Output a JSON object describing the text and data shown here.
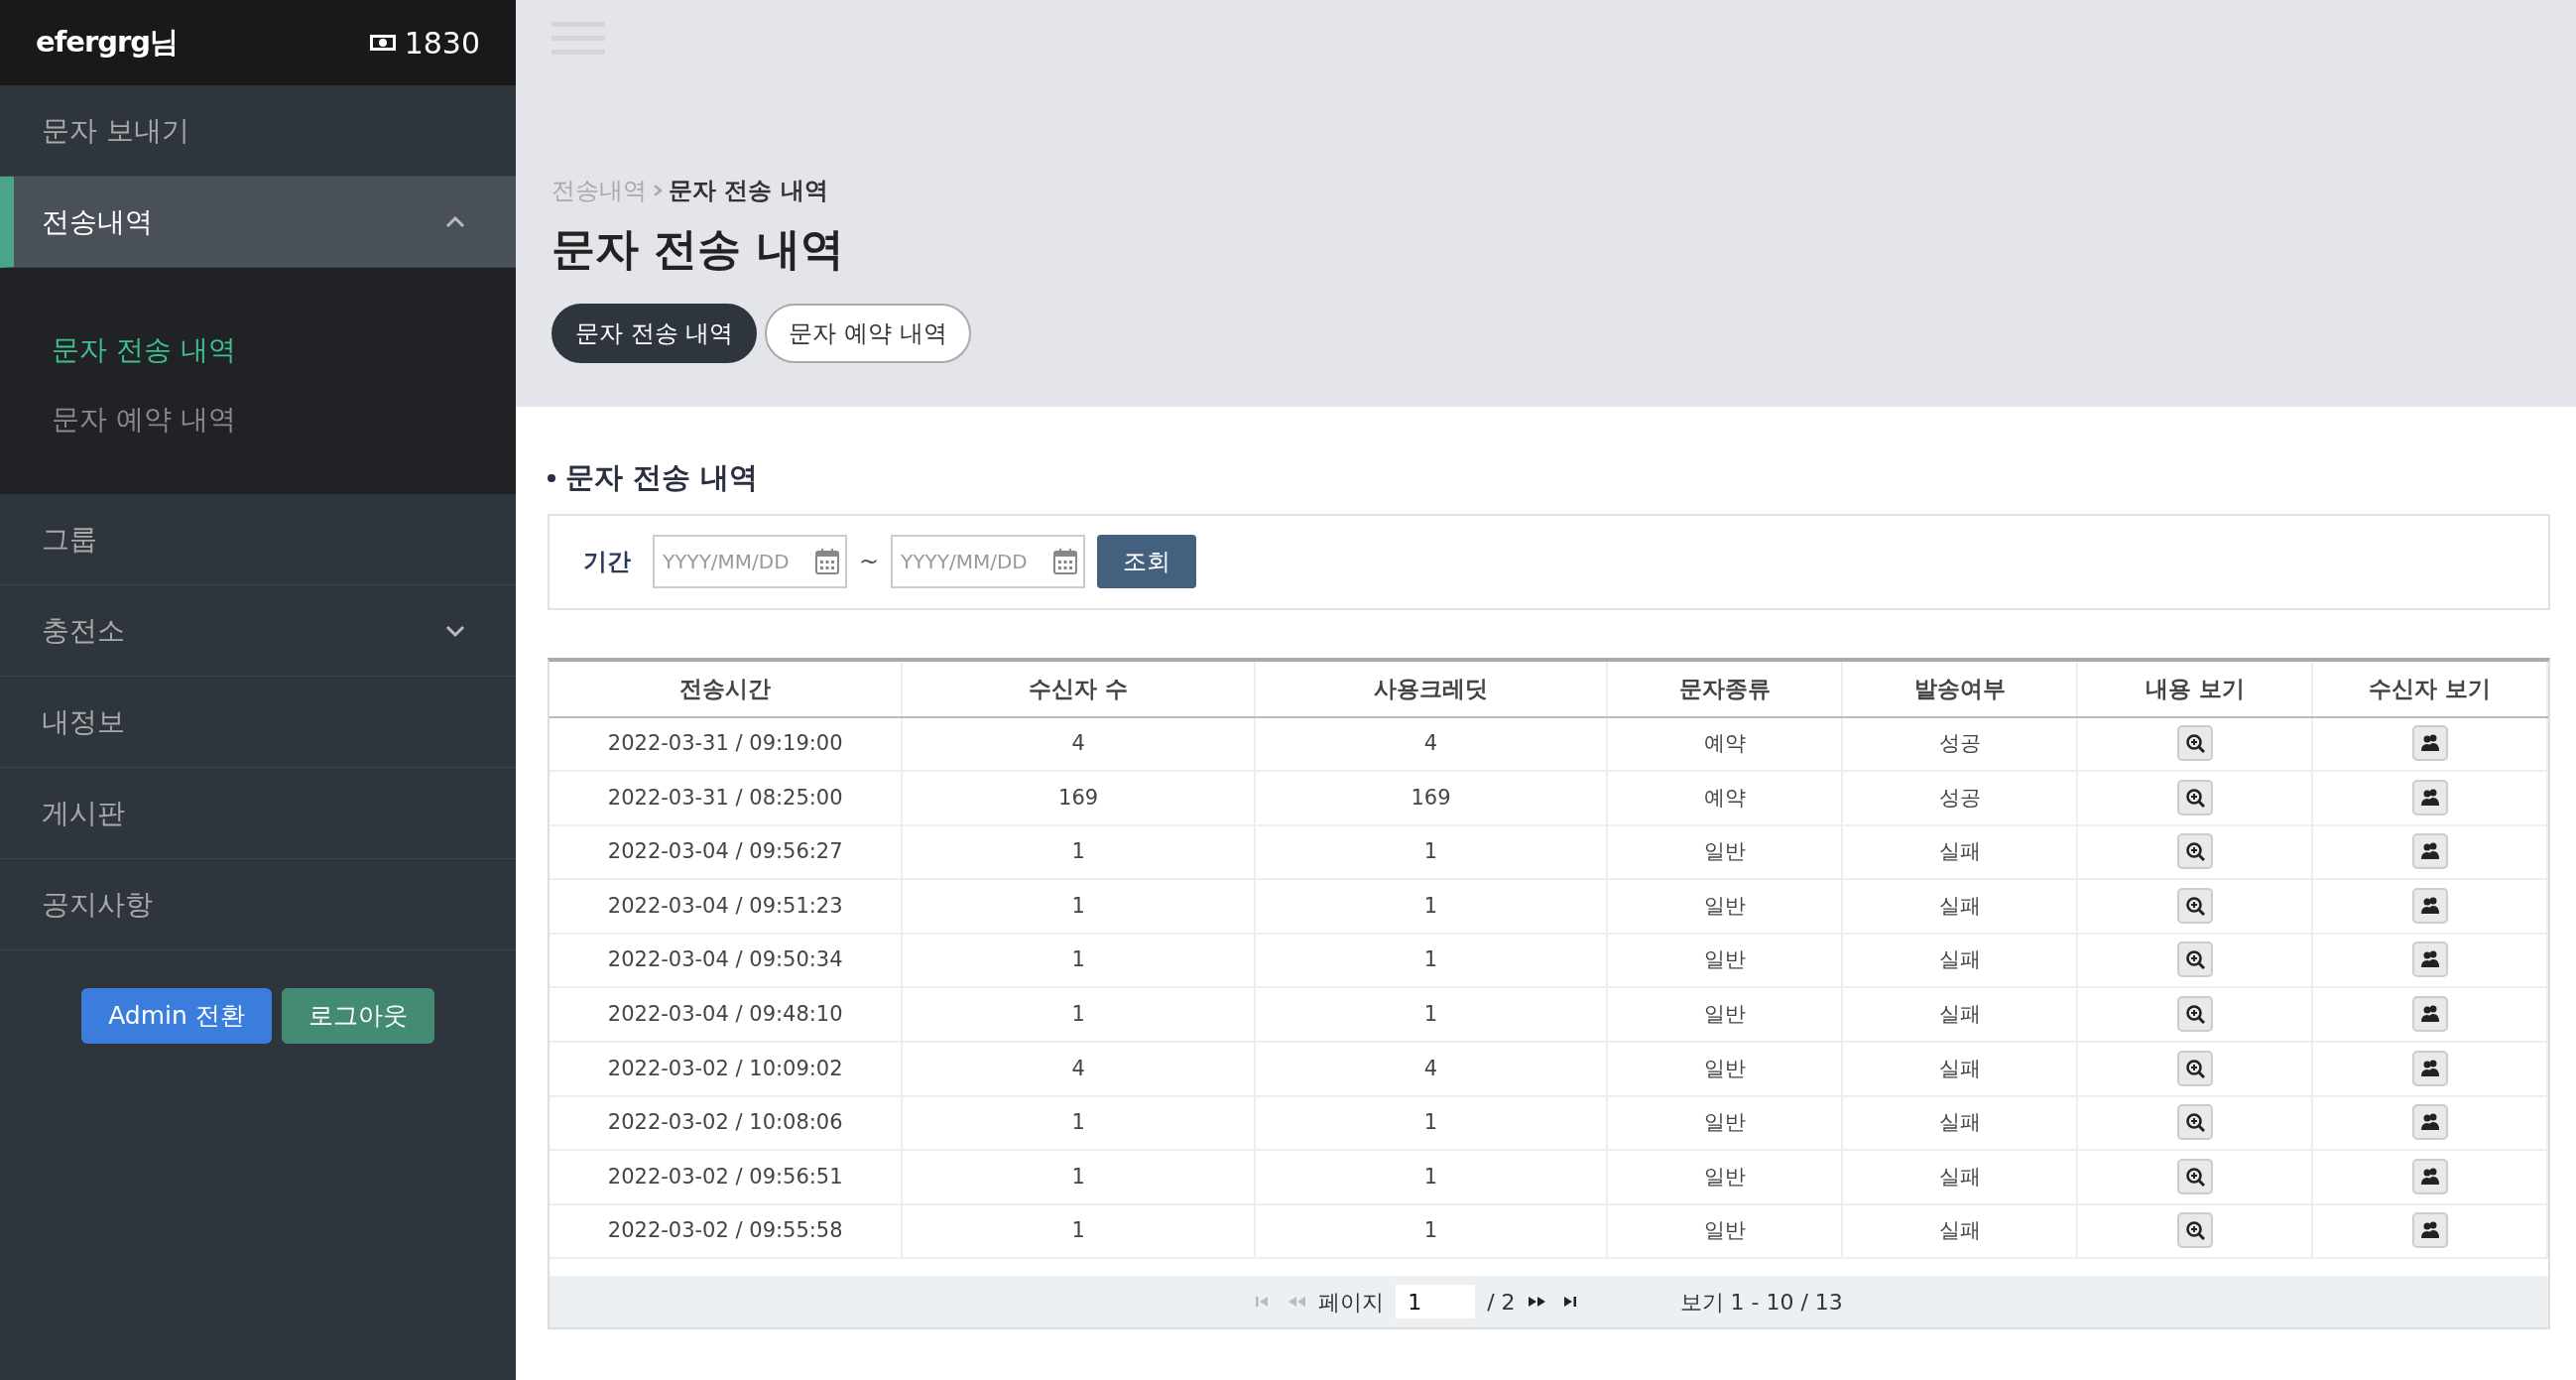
{
  "sidebar": {
    "user": "efergrg님",
    "credit": "1830",
    "menu": [
      {
        "label": "문자 보내기",
        "kind": "link",
        "selected": false
      },
      {
        "label": "전송내역",
        "kind": "group",
        "selected": true,
        "expanded": true,
        "children": [
          {
            "label": "문자 전송 내역",
            "selected": true
          },
          {
            "label": "문자 예약 내역",
            "selected": false
          }
        ]
      },
      {
        "label": "그룹",
        "kind": "link",
        "selected": false
      },
      {
        "label": "충전소",
        "kind": "group",
        "selected": false,
        "expanded": false
      },
      {
        "label": "내정보",
        "kind": "link",
        "selected": false
      },
      {
        "label": "게시판",
        "kind": "link",
        "selected": false
      },
      {
        "label": "공지사항",
        "kind": "link",
        "selected": false
      }
    ],
    "buttons": [
      {
        "label": "Admin 전환",
        "kind": "primary"
      },
      {
        "label": "로그아웃",
        "kind": "success"
      }
    ]
  },
  "breadcrumb": {
    "parent": "전송내역",
    "current": "문자 전송 내역"
  },
  "title": "문자 전송 내역",
  "tabs": [
    {
      "label": "문자 전송 내역",
      "selected": true
    },
    {
      "label": "문자 예약 내역",
      "selected": false
    }
  ],
  "section_title": "문자 전송 내역",
  "filter": {
    "label": "기간",
    "from": {
      "placeholder": "YYYY/MM/DD"
    },
    "separator": "~",
    "to": {
      "placeholder": "YYYY/MM/DD"
    },
    "button": "조회"
  },
  "table": {
    "columns": [
      "전송시간",
      "수신자 수",
      "사용크레딧",
      "문자종류",
      "발송여부",
      "내용 보기",
      "수신자 보기"
    ],
    "rows": [
      [
        "2022-03-31 / 09:19:00",
        "4",
        "4",
        "예약",
        "성공"
      ],
      [
        "2022-03-31 / 08:25:00",
        "169",
        "169",
        "예약",
        "성공"
      ],
      [
        "2022-03-04 / 09:56:27",
        "1",
        "1",
        "일반",
        "실패"
      ],
      [
        "2022-03-04 / 09:51:23",
        "1",
        "1",
        "일반",
        "실패"
      ],
      [
        "2022-03-04 / 09:50:34",
        "1",
        "1",
        "일반",
        "실패"
      ],
      [
        "2022-03-04 / 09:48:10",
        "1",
        "1",
        "일반",
        "실패"
      ],
      [
        "2022-03-02 / 10:09:02",
        "4",
        "4",
        "일반",
        "실패"
      ],
      [
        "2022-03-02 / 10:08:06",
        "1",
        "1",
        "일반",
        "실패"
      ],
      [
        "2022-03-02 / 09:56:51",
        "1",
        "1",
        "일반",
        "실패"
      ],
      [
        "2022-03-02 / 09:55:58",
        "1",
        "1",
        "일반",
        "실패"
      ]
    ]
  },
  "pager": {
    "first_disabled": true,
    "prev_disabled": true,
    "next_disabled": false,
    "last_disabled": false,
    "page_label": "페이지",
    "page": "1",
    "total_pages": "/ 2",
    "summary": "보기 1 - 10 / 13"
  }
}
